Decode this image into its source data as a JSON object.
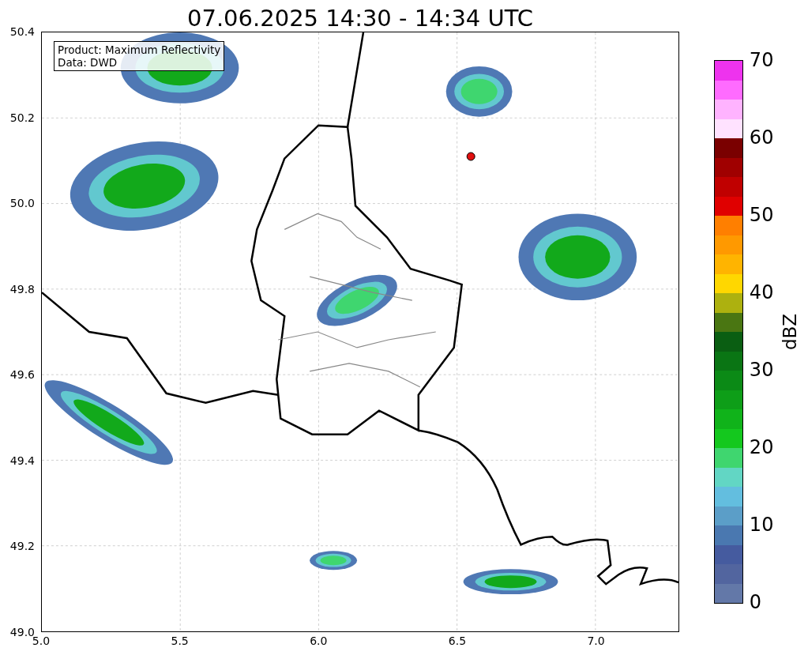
{
  "title": "07.06.2025 14:30 - 14:34 UTC",
  "info_box": [
    "Product: Maximum Reflectivity",
    "Data: DWD"
  ],
  "x_ticks": [
    "5.0",
    "5.5",
    "6.0",
    "6.5",
    "7.0"
  ],
  "y_ticks": [
    "50.4",
    "50.2",
    "50.0",
    "49.8",
    "49.6",
    "49.4",
    "49.2",
    "49.0"
  ],
  "colorbar": {
    "label": "dBZ",
    "ticks": [
      "70",
      "60",
      "50",
      "40",
      "30",
      "20",
      "10",
      "0"
    ],
    "segments": [
      {
        "color": "#ee33ee"
      },
      {
        "color": "#ff6bff"
      },
      {
        "color": "#ffb3ff"
      },
      {
        "color": "#ffe2ff"
      },
      {
        "color": "#7a0000"
      },
      {
        "color": "#a00000"
      },
      {
        "color": "#c00000"
      },
      {
        "color": "#e00000"
      },
      {
        "color": "#ff7f00"
      },
      {
        "color": "#ff9900"
      },
      {
        "color": "#ffb400"
      },
      {
        "color": "#ffd700"
      },
      {
        "color": "#adb10f"
      },
      {
        "color": "#4a7612"
      },
      {
        "color": "#0a5e12"
      },
      {
        "color": "#0a7514"
      },
      {
        "color": "#0b8a16"
      },
      {
        "color": "#0e9e18"
      },
      {
        "color": "#10b31a"
      },
      {
        "color": "#14c81e"
      },
      {
        "color": "#3fd66f"
      },
      {
        "color": "#62d6c4"
      },
      {
        "color": "#63bedf"
      },
      {
        "color": "#5b9ec8"
      },
      {
        "color": "#4a78b0"
      },
      {
        "color": "#455b9f"
      },
      {
        "color": "#52659f"
      },
      {
        "color": "#6378a8"
      }
    ]
  }
}
